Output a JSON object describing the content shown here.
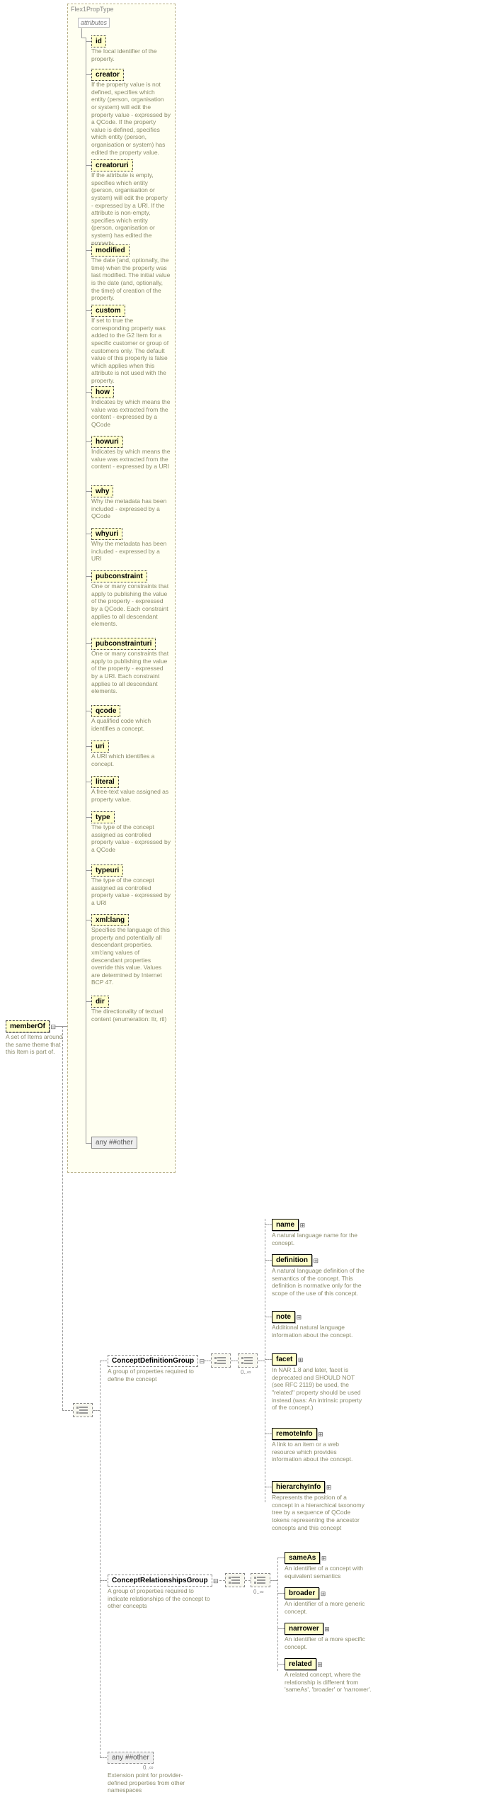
{
  "outer_label": "Flex1PropType",
  "attributes_label": "attributes",
  "memberOf": {
    "label": "memberOf",
    "desc": "A set of Items around the same theme that this Item is part of."
  },
  "attrs": [
    {
      "name": "id",
      "desc": "The local identifier of the property."
    },
    {
      "name": "creator",
      "desc": "If the property value is not defined, specifies which entity (person, organisation or system) will edit the property value - expressed by a QCode. If the property value is defined, specifies which entity (person, organisation or system) has edited the property value."
    },
    {
      "name": "creatoruri",
      "desc": "If the attribute is empty, specifies which entity (person, organisation or system) will edit the property - expressed by a URI. If the attribute is non-empty, specifies which entity (person, organisation or system) has edited the property."
    },
    {
      "name": "modified",
      "desc": "The date (and, optionally, the time) when the property was last modified. The initial value is the date (and, optionally, the time) of creation of the property."
    },
    {
      "name": "custom",
      "desc": "If set to true the corresponding property was added to the G2 Item for a specific customer or group of customers only. The default value of this property is false which applies when this attribute is not used with the property."
    },
    {
      "name": "how",
      "desc": "Indicates by which means the value was extracted from the content - expressed by a QCode"
    },
    {
      "name": "howuri",
      "desc": "Indicates by which means the value was extracted from the content - expressed by a URI"
    },
    {
      "name": "why",
      "desc": "Why the metadata has been included - expressed by a QCode"
    },
    {
      "name": "whyuri",
      "desc": "Why the metadata has been included - expressed by a URI"
    },
    {
      "name": "pubconstraint",
      "desc": "One or many constraints that apply to publishing the value of the property - expressed by a QCode. Each constraint applies to all descendant elements."
    },
    {
      "name": "pubconstrainturi",
      "desc": "One or many constraints that apply to publishing the value of the property - expressed by a URI. Each constraint applies to all descendant elements."
    },
    {
      "name": "qcode",
      "desc": "A qualified code which identifies a concept."
    },
    {
      "name": "uri",
      "desc": "A URI which identifies a concept."
    },
    {
      "name": "literal",
      "desc": "A free-text value assigned as property value."
    },
    {
      "name": "type",
      "desc": "The type of the concept assigned as controlled property value - expressed by a QCode"
    },
    {
      "name": "typeuri",
      "desc": "The type of the concept assigned as controlled property value - expressed by a URI"
    },
    {
      "name": "xml:lang",
      "desc": "Specifies the language of this property and potentially all descendant properties. xml:lang values of descendant properties override this value. Values are determined by Internet BCP 47."
    },
    {
      "name": "dir",
      "desc": "The directionality of textual content (enumeration: ltr, rtl)"
    }
  ],
  "any_inner": "any ##other",
  "groups": {
    "defn": {
      "label": "ConceptDefinitionGroup",
      "desc": "A group of properties required to define the concept"
    },
    "rel": {
      "label": "ConceptRelationshipsGroup",
      "desc": "A group of properties required to indicate relationships of the concept to other concepts"
    }
  },
  "defn_children": [
    {
      "name": "name",
      "desc": "A natural language name for the concept."
    },
    {
      "name": "definition",
      "desc": "A natural language definition of the semantics of the concept. This definition is normative only for the scope of the use of this concept."
    },
    {
      "name": "note",
      "desc": "Additional natural language information about the concept."
    },
    {
      "name": "facet",
      "desc": "In NAR 1.8 and later, facet is deprecated and SHOULD NOT (see RFC 2119) be used, the \"related\" property should be used instead.(was: An intrinsic property of the concept.)"
    },
    {
      "name": "remoteInfo",
      "desc": "A link to an item or a web resource which provides information about the concept."
    },
    {
      "name": "hierarchyInfo",
      "desc": "Represents the position of a concept in a hierarchical taxonomy tree by a sequence of QCode tokens representing the ancestor concepts and this concept"
    }
  ],
  "rel_children": [
    {
      "name": "sameAs",
      "desc": "An identifier of a concept with equivalent semantics"
    },
    {
      "name": "broader",
      "desc": "An identifier of a more generic concept."
    },
    {
      "name": "narrower",
      "desc": "An identifier of a more specific concept."
    },
    {
      "name": "related",
      "desc": "A related concept, where the relationship is different from 'sameAs', 'broader' or 'narrower'."
    }
  ],
  "ext": {
    "label": "any ##other",
    "desc": "Extension point for provider-defined properties from other namespaces"
  },
  "cardinality": "0..∞"
}
